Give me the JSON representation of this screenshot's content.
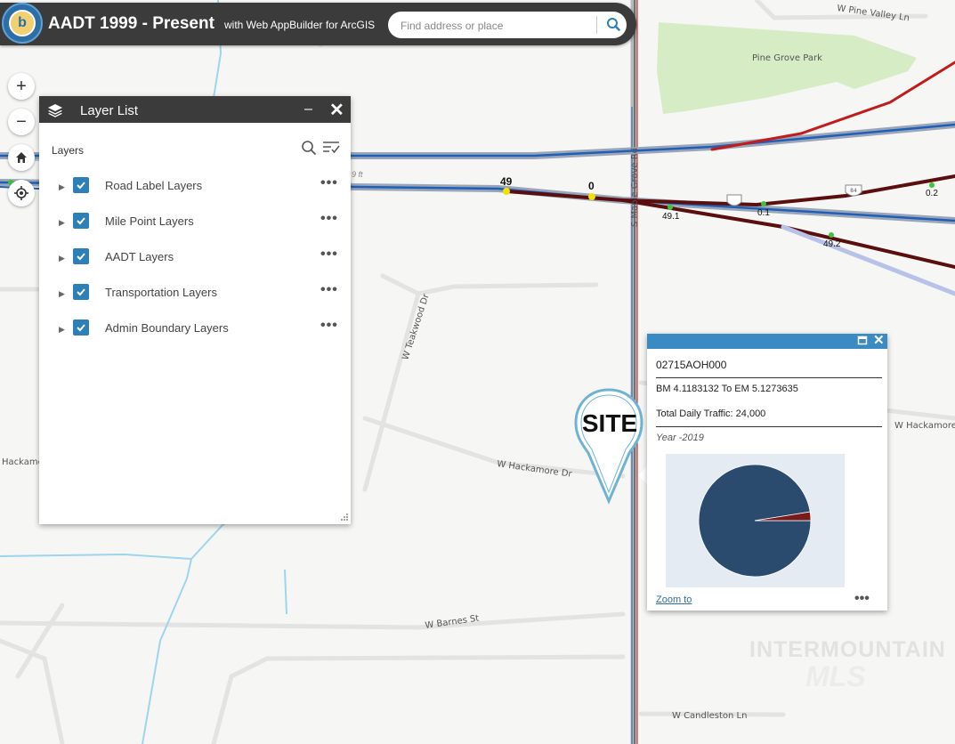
{
  "header": {
    "title": "AADT 1999 - Present",
    "subtitle": "with Web AppBuilder for ArcGIS",
    "search_placeholder": "Find address or place"
  },
  "map_controls": {
    "zoom_in": "+",
    "zoom_out": "−"
  },
  "map_labels": {
    "streets": [
      "W Pine Valley Ln",
      "W Teakwood Dr",
      "W Hackamore Dr",
      "W Hackamore",
      "Hackamore",
      "W Barnes St",
      "W Candleston Ln",
      "S Maple Grove Rd"
    ],
    "park": "Pine Grove Park",
    "mileposts": [
      "49",
      "0",
      "49.1",
      "0.1",
      "49.2",
      "0.2"
    ],
    "partial_label": "9 ft",
    "shields": [
      "84"
    ]
  },
  "layer_panel": {
    "title": "Layer List",
    "heading": "Layers",
    "layers": [
      {
        "label": "Road Label Layers",
        "checked": true
      },
      {
        "label": "Mile Point Layers",
        "checked": true
      },
      {
        "label": "AADT Layers",
        "checked": true
      },
      {
        "label": "Transportation Layers",
        "checked": true
      },
      {
        "label": "Admin Boundary Layers",
        "checked": true
      }
    ],
    "more_glyph": "•••"
  },
  "popup": {
    "id": "02715AOH000",
    "range": "BM 4.1183132 To EM 5.1273635",
    "traffic": "Total Daily Traffic: 24,000",
    "year": "Year -2019",
    "zoom_link": "Zoom to",
    "more_glyph": "•••"
  },
  "chart_data": {
    "type": "pie",
    "slices": [
      {
        "label": "",
        "value": 97.5,
        "color": "#2a4a6e"
      },
      {
        "label": "",
        "value": 2.5,
        "color": "#7a1a1a"
      }
    ]
  },
  "marker": {
    "text": "SITE"
  },
  "watermark": {
    "line1": "INTERMOUNTAIN",
    "line2": "MLS"
  },
  "colors": {
    "header_bg": "#3b3b3b",
    "accent_blue": "#2d7fb8",
    "popup_header": "#3a8bc3",
    "road_blue": "#1f5fb8",
    "road_red": "#c21b1b",
    "road_darkred": "#5a0e0e",
    "park_green": "#d6ecc4"
  }
}
